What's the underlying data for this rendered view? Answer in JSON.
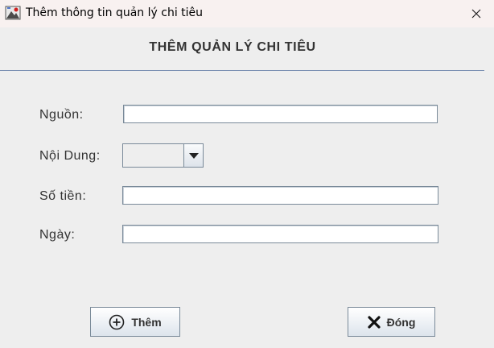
{
  "window": {
    "title": "Thêm thông tin quản lý chi tiêu",
    "icon": "app-icon",
    "close_icon": "close-icon"
  },
  "header": {
    "title": "THÊM QUẢN LÝ CHI TIÊU"
  },
  "form": {
    "source": {
      "label": "Nguồn:",
      "value": ""
    },
    "content": {
      "label": "Nội Dung:",
      "selected": "",
      "arrow_icon": "chevron-down-icon"
    },
    "amount": {
      "label": "Số tiền:",
      "value": ""
    },
    "date": {
      "label": "Ngày:",
      "value": ""
    }
  },
  "buttons": {
    "add": {
      "label": "Thêm",
      "icon": "plus-circle-icon"
    },
    "close": {
      "label": "Đóng",
      "icon": "x-icon"
    }
  },
  "colors": {
    "background": "#eeeeee",
    "titlebar": "#f8f1f0",
    "separator": "#7a8fb2",
    "text": "#333333"
  }
}
